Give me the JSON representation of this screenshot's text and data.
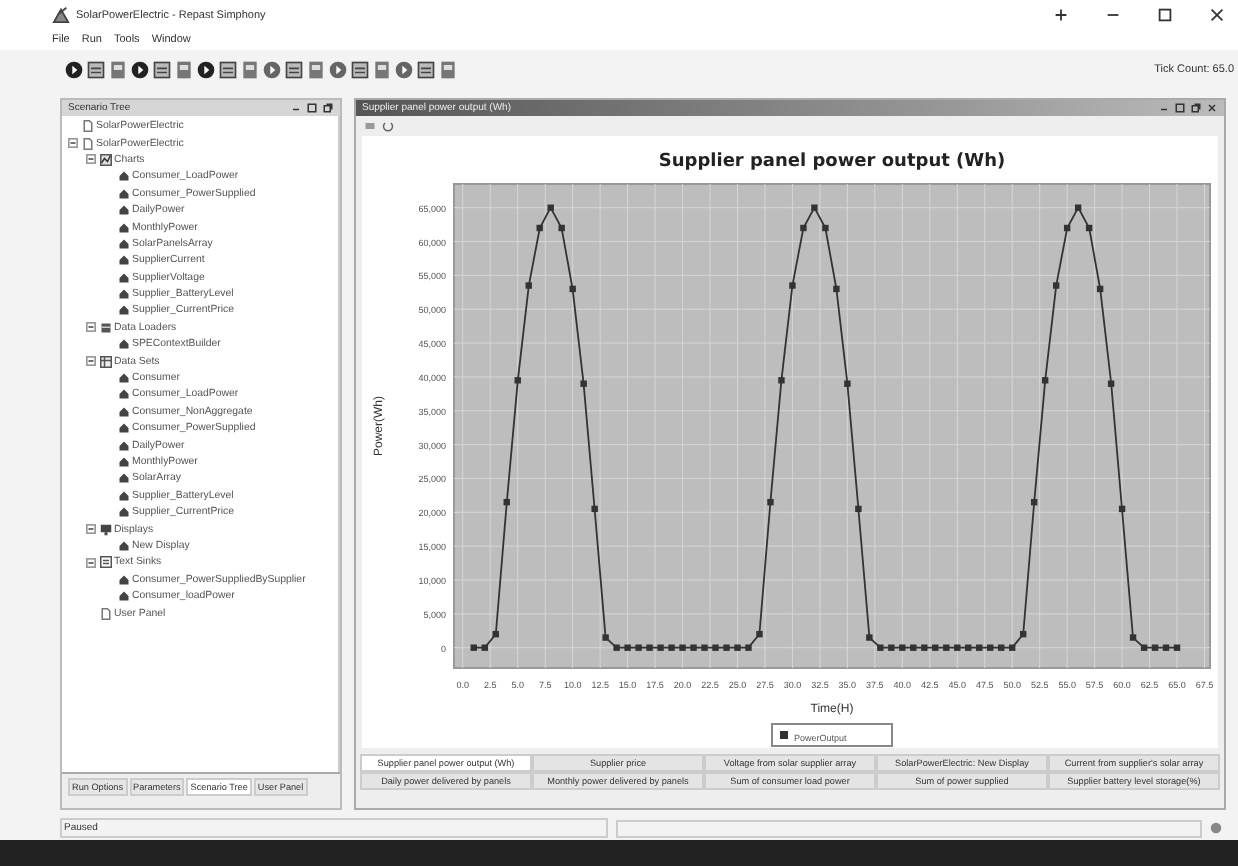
{
  "window": {
    "title": "SolarPowerElectric - Repast Simphony"
  },
  "menu": [
    "File",
    "Run",
    "Tools",
    "Window"
  ],
  "tick_count": "Tick Count: 65.0",
  "left_panel": {
    "title": "Scenario Tree",
    "tree": [
      {
        "label": "SolarPowerElectric",
        "kind": "file"
      },
      {
        "label": "SolarPowerElectric",
        "kind": "file",
        "children": [
          {
            "label": "Charts",
            "kind": "charts",
            "children": [
              {
                "label": "Consumer_LoadPower",
                "kind": "leaf"
              },
              {
                "label": "Consumer_PowerSupplied",
                "kind": "leaf"
              },
              {
                "label": "DailyPower",
                "kind": "leaf"
              },
              {
                "label": "MonthlyPower",
                "kind": "leaf"
              },
              {
                "label": "SolarPanelsArray",
                "kind": "leaf"
              },
              {
                "label": "SupplierCurrent",
                "kind": "leaf"
              },
              {
                "label": "SupplierVoltage",
                "kind": "leaf"
              },
              {
                "label": "Supplier_BatteryLevel",
                "kind": "leaf"
              },
              {
                "label": "Supplier_CurrentPrice",
                "kind": "leaf"
              }
            ]
          },
          {
            "label": "Data Loaders",
            "kind": "loaders",
            "children": [
              {
                "label": "SPEContextBuilder",
                "kind": "leaf"
              }
            ]
          },
          {
            "label": "Data Sets",
            "kind": "datasets",
            "children": [
              {
                "label": "Consumer",
                "kind": "leaf"
              },
              {
                "label": "Consumer_LoadPower",
                "kind": "leaf"
              },
              {
                "label": "Consumer_NonAggregate",
                "kind": "leaf"
              },
              {
                "label": "Consumer_PowerSupplied",
                "kind": "leaf"
              },
              {
                "label": "DailyPower",
                "kind": "leaf"
              },
              {
                "label": "MonthlyPower",
                "kind": "leaf"
              },
              {
                "label": "SolarArray",
                "kind": "leaf"
              },
              {
                "label": "Supplier_BatteryLevel",
                "kind": "leaf"
              },
              {
                "label": "Supplier_CurrentPrice",
                "kind": "leaf"
              }
            ]
          },
          {
            "label": "Displays",
            "kind": "displays",
            "children": [
              {
                "label": "New Display",
                "kind": "leaf"
              }
            ]
          },
          {
            "label": "Text Sinks",
            "kind": "sinks",
            "children": [
              {
                "label": "Consumer_PowerSuppliedBySupplier",
                "kind": "leaf"
              },
              {
                "label": "Consumer_loadPower",
                "kind": "leaf"
              }
            ]
          },
          {
            "label": "User Panel",
            "kind": "file"
          }
        ]
      }
    ],
    "tabs": [
      {
        "label": "Run Options",
        "selected": false
      },
      {
        "label": "Parameters",
        "selected": false
      },
      {
        "label": "Scenario Tree",
        "selected": true
      },
      {
        "label": "User Panel",
        "selected": false
      }
    ]
  },
  "chart_panel": {
    "title": "Supplier panel power output (Wh)",
    "chart_data": {
      "type": "line",
      "title": "Supplier panel power output (Wh)",
      "xlabel": "Time(H)",
      "ylabel": "Power(Wh)",
      "x": [
        1,
        2,
        3,
        4,
        5,
        6,
        7,
        8,
        9,
        10,
        11,
        12,
        13,
        14,
        15,
        16,
        17,
        18,
        19,
        20,
        21,
        22,
        23,
        24,
        25,
        26,
        27,
        28,
        29,
        30,
        31,
        32,
        33,
        34,
        35,
        36,
        37,
        38,
        39,
        40,
        41,
        42,
        43,
        44,
        45,
        46,
        47,
        48,
        49,
        50,
        51,
        52,
        53,
        54,
        55,
        56,
        57,
        58,
        59,
        60,
        61,
        62,
        63,
        64,
        65
      ],
      "series": [
        {
          "name": "PowerOutput",
          "color": "#333333",
          "marker": "square",
          "values": [
            0,
            0,
            2000,
            21500,
            39500,
            53500,
            62000,
            65000,
            62000,
            53000,
            39000,
            20500,
            1500,
            0,
            0,
            0,
            0,
            0,
            0,
            0,
            0,
            0,
            0,
            0,
            0,
            0,
            2000,
            21500,
            39500,
            53500,
            62000,
            65000,
            62000,
            53000,
            39000,
            20500,
            1500,
            0,
            0,
            0,
            0,
            0,
            0,
            0,
            0,
            0,
            0,
            0,
            0,
            0,
            2000,
            21500,
            39500,
            53500,
            62000,
            65000,
            62000,
            53000,
            39000,
            20500,
            1500,
            0,
            0,
            0,
            0
          ]
        }
      ],
      "grid": true,
      "xlim": [
        -0.8,
        68
      ],
      "ylim": [
        -3000,
        68500
      ],
      "xticks": [
        {
          "value": 0,
          "label": "0.0"
        },
        {
          "value": 2.5,
          "label": "2.5"
        },
        {
          "value": 5,
          "label": "5.0"
        },
        {
          "value": 7.5,
          "label": "7.5"
        },
        {
          "value": 10,
          "label": "10.0"
        },
        {
          "value": 12.5,
          "label": "12.5"
        },
        {
          "value": 15,
          "label": "15.0"
        },
        {
          "value": 17.5,
          "label": "17.5"
        },
        {
          "value": 20,
          "label": "20.0"
        },
        {
          "value": 22.5,
          "label": "22.5"
        },
        {
          "value": 25,
          "label": "25.0"
        },
        {
          "value": 27.5,
          "label": "27.5"
        },
        {
          "value": 30,
          "label": "30.0"
        },
        {
          "value": 32.5,
          "label": "32.5"
        },
        {
          "value": 35,
          "label": "35.0"
        },
        {
          "value": 37.5,
          "label": "37.5"
        },
        {
          "value": 40,
          "label": "40.0"
        },
        {
          "value": 42.5,
          "label": "42.5"
        },
        {
          "value": 45,
          "label": "45.0"
        },
        {
          "value": 47.5,
          "label": "47.5"
        },
        {
          "value": 50,
          "label": "50.0"
        },
        {
          "value": 52.5,
          "label": "52.5"
        },
        {
          "value": 55,
          "label": "55.0"
        },
        {
          "value": 57.5,
          "label": "57.5"
        },
        {
          "value": 60,
          "label": "60.0"
        },
        {
          "value": 62.5,
          "label": "62.5"
        },
        {
          "value": 65,
          "label": "65.0"
        },
        {
          "value": 67.5,
          "label": "67.5"
        }
      ],
      "yticks": [
        {
          "value": 0,
          "label": "0"
        },
        {
          "value": 5000,
          "label": "5,000"
        },
        {
          "value": 10000,
          "label": "10,000"
        },
        {
          "value": 15000,
          "label": "15,000"
        },
        {
          "value": 20000,
          "label": "20,000"
        },
        {
          "value": 25000,
          "label": "25,000"
        },
        {
          "value": 30000,
          "label": "30,000"
        },
        {
          "value": 35000,
          "label": "35,000"
        },
        {
          "value": 40000,
          "label": "40,000"
        },
        {
          "value": 45000,
          "label": "45,000"
        },
        {
          "value": 50000,
          "label": "50,000"
        },
        {
          "value": 55000,
          "label": "55,000"
        },
        {
          "value": 60000,
          "label": "60,000"
        },
        {
          "value": 65000,
          "label": "65,000"
        }
      ]
    },
    "tab_rows": [
      [
        {
          "label": "Supplier panel power output (Wh)",
          "selected": true
        },
        {
          "label": "Supplier price",
          "selected": false
        },
        {
          "label": "Voltage from solar supplier array",
          "selected": false
        },
        {
          "label": "SolarPowerElectric: New Display",
          "selected": false
        },
        {
          "label": "Current from supplier's solar array",
          "selected": false
        }
      ],
      [
        {
          "label": "Daily power delivered by panels",
          "selected": false
        },
        {
          "label": "Monthly power delivered by panels",
          "selected": false
        },
        {
          "label": "Sum of consumer load power",
          "selected": false
        },
        {
          "label": "Sum of power supplied",
          "selected": false
        },
        {
          "label": "Supplier battery level storage(%)",
          "selected": false
        }
      ]
    ]
  },
  "status_bar": {
    "text": "Paused"
  }
}
